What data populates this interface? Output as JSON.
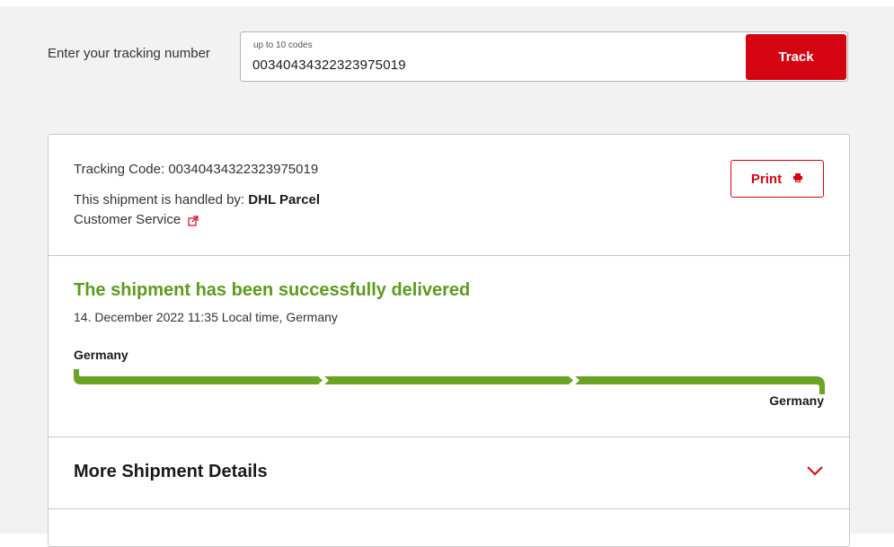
{
  "search": {
    "label": "Enter your tracking number",
    "hint": "up to 10 codes",
    "value": "00340434322323975019",
    "button": "Track"
  },
  "shipment": {
    "tracking_code_label": "Tracking Code:",
    "tracking_code": "00340434322323975019",
    "handled_by_label": "This shipment is handled by:",
    "handled_by": "DHL Parcel",
    "customer_service": "Customer Service",
    "print_label": "Print"
  },
  "status": {
    "title": "The shipment has been successfully delivered",
    "date": "14. December 2022 11:35 Local time, Germany",
    "origin": "Germany",
    "destination": "Germany",
    "progress_segments_complete": 3,
    "progress_segments_total": 3
  },
  "more": {
    "title": "More Shipment Details"
  },
  "colors": {
    "brand_red": "#d40511",
    "success_green": "#5c9b1e",
    "progress_green": "#6aa326"
  },
  "icons": {
    "print": "printer-icon",
    "external": "external-link-icon",
    "chevron": "chevron-down-icon"
  }
}
